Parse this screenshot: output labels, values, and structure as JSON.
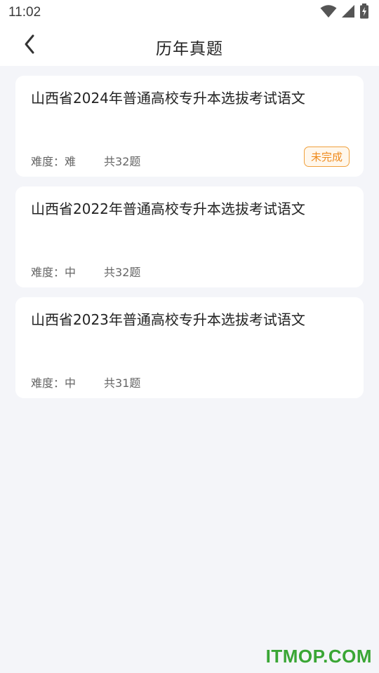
{
  "status_bar": {
    "time": "11:02",
    "icons": [
      "wifi-icon",
      "signal-icon",
      "battery-charging-icon"
    ]
  },
  "header": {
    "back_icon": "chevron-left-icon",
    "title": "历年真题"
  },
  "exams": [
    {
      "title": "山西省2024年普通高校专升本选拔考试语文",
      "difficulty": "难度：难",
      "count": "共32题",
      "status": "未完成"
    },
    {
      "title": "山西省2022年普通高校专升本选拔考试语文",
      "difficulty": "难度：中",
      "count": "共32题",
      "status": ""
    },
    {
      "title": "山西省2023年普通高校专升本选拔考试语文",
      "difficulty": "难度：中",
      "count": "共31题",
      "status": ""
    }
  ],
  "watermark": "ITMOP.COM",
  "colors": {
    "background": "#f4f5f9",
    "badge_accent": "#ef8a1c",
    "watermark": "#3aa635"
  }
}
